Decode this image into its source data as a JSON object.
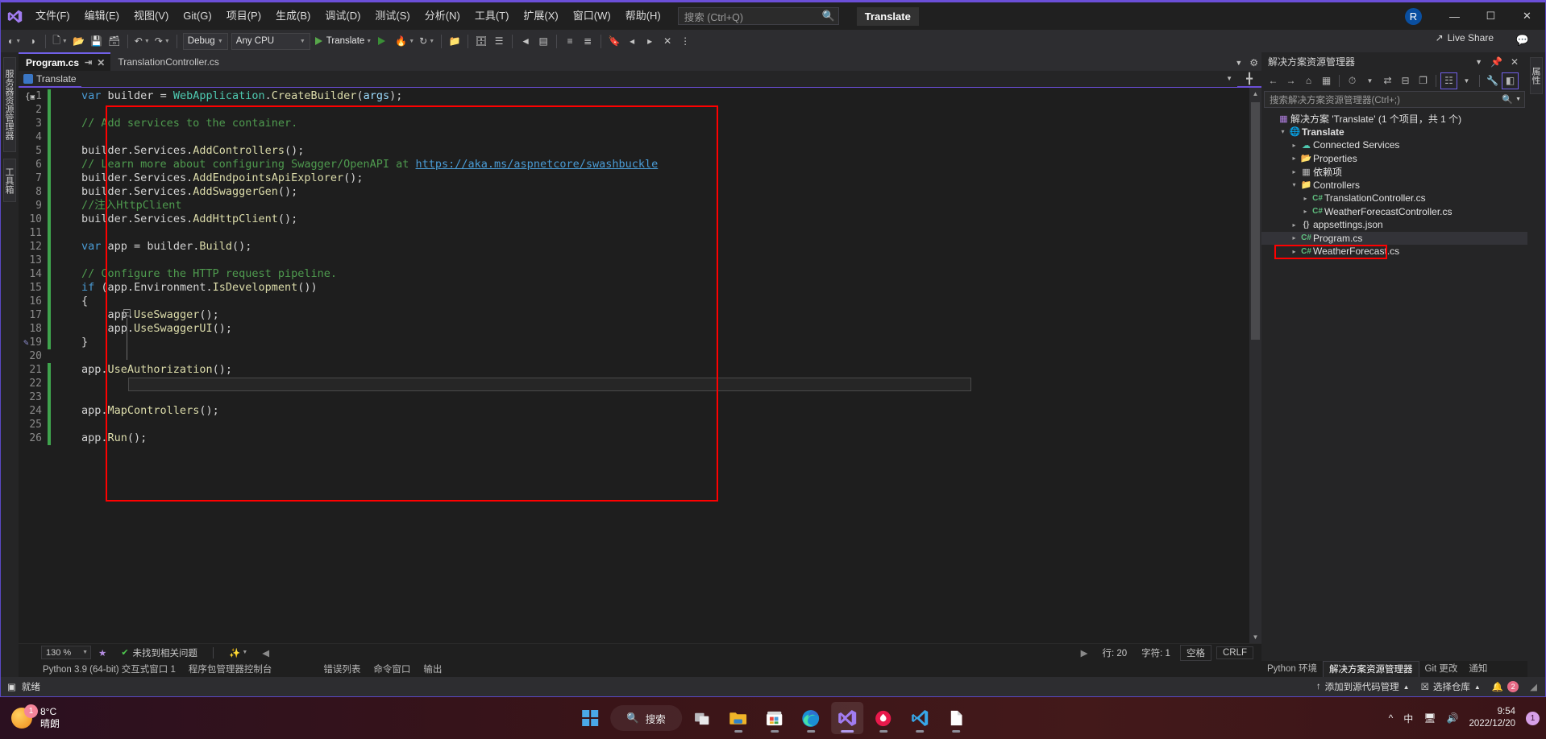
{
  "window": {
    "menu": [
      {
        "label": "文件(F)"
      },
      {
        "label": "编辑(E)"
      },
      {
        "label": "视图(V)"
      },
      {
        "label": "Git(G)"
      },
      {
        "label": "项目(P)"
      },
      {
        "label": "生成(B)"
      },
      {
        "label": "调试(D)"
      },
      {
        "label": "测试(S)"
      },
      {
        "label": "分析(N)"
      },
      {
        "label": "工具(T)"
      },
      {
        "label": "扩展(X)"
      },
      {
        "label": "窗口(W)"
      },
      {
        "label": "帮助(H)"
      }
    ],
    "search_placeholder": "搜索 (Ctrl+Q)",
    "doc_title": "Translate",
    "avatar_initial": "R",
    "minimize": "—",
    "maximize": "☐",
    "close": "✕",
    "live_share": "Live Share"
  },
  "toolbar": {
    "config": "Debug",
    "platform": "Any CPU",
    "run_label": "Translate"
  },
  "left_rail": [
    {
      "label": "服务器资源管理器"
    },
    {
      "label": "工具箱"
    }
  ],
  "far_rail": [
    {
      "label": "属性"
    }
  ],
  "editor": {
    "tabs": [
      {
        "label": "Program.cs",
        "active": true,
        "pin": "⇥",
        "close": "✕"
      },
      {
        "label": "TranslationController.cs",
        "active": false
      }
    ],
    "navbar_project": "Translate",
    "zoom": "130 %",
    "issue_status": "未找到相关问题",
    "line_label": "行: 20",
    "col_label": "字符: 1",
    "spaces_label": "空格",
    "eol_label": "CRLF",
    "code": [
      {
        "n": "1",
        "changed": true,
        "html": "<span class='kw'>var</span> <span class='id'>builder</span> = <span class='type'>WebApplication</span>.<span class='fn'>CreateBuilder</span>(<span class='var'>args</span>);"
      },
      {
        "n": "2",
        "changed": true,
        "html": ""
      },
      {
        "n": "3",
        "changed": true,
        "html": "<span class='cmt'>// Add services to the container.</span>"
      },
      {
        "n": "4",
        "changed": true,
        "html": ""
      },
      {
        "n": "5",
        "changed": true,
        "html": "<span class='id'>builder</span>.<span class='id'>Services</span>.<span class='fn'>AddControllers</span>();"
      },
      {
        "n": "6",
        "changed": true,
        "html": "<span class='cmt'>// Learn more about configuring Swagger/OpenAPI at </span><span class='link'>https://aka.ms/aspnetcore/swashbuckle</span>"
      },
      {
        "n": "7",
        "changed": true,
        "html": "<span class='id'>builder</span>.<span class='id'>Services</span>.<span class='fn'>AddEndpointsApiExplorer</span>();"
      },
      {
        "n": "8",
        "changed": true,
        "html": "<span class='id'>builder</span>.<span class='id'>Services</span>.<span class='fn'>AddSwaggerGen</span>();"
      },
      {
        "n": "9",
        "changed": true,
        "html": "<span class='cmt'>//注入HttpClient</span>"
      },
      {
        "n": "10",
        "changed": true,
        "html": "<span class='id'>builder</span>.<span class='id'>Services</span>.<span class='fn'>AddHttpClient</span>();"
      },
      {
        "n": "11",
        "changed": true,
        "html": ""
      },
      {
        "n": "12",
        "changed": true,
        "html": "<span class='kw'>var</span> <span class='id'>app</span> = <span class='id'>builder</span>.<span class='fn'>Build</span>();"
      },
      {
        "n": "13",
        "changed": true,
        "html": ""
      },
      {
        "n": "14",
        "changed": true,
        "html": "<span class='cmt'>// Configure the HTTP request pipeline.</span>"
      },
      {
        "n": "15",
        "changed": true,
        "html": "<span class='kw'>if</span> (<span class='id'>app</span>.<span class='id'>Environment</span>.<span class='fn'>IsDevelopment</span>())"
      },
      {
        "n": "16",
        "changed": true,
        "html": "{"
      },
      {
        "n": "17",
        "changed": true,
        "html": "    <span class='id'>app</span>.<span class='fn'>UseSwagger</span>();"
      },
      {
        "n": "18",
        "changed": true,
        "html": "    <span class='id'>app</span>.<span class='fn'>UseSwaggerUI</span>();"
      },
      {
        "n": "19",
        "changed": true,
        "html": "}"
      },
      {
        "n": "20",
        "changed": false,
        "html": ""
      },
      {
        "n": "21",
        "changed": true,
        "html": "<span class='id'>app</span>.<span class='fn'>UseAuthorization</span>();"
      },
      {
        "n": "22",
        "changed": true,
        "html": ""
      },
      {
        "n": "23",
        "changed": true,
        "html": ""
      },
      {
        "n": "24",
        "changed": true,
        "html": "<span class='id'>app</span>.<span class='fn'>MapControllers</span>();"
      },
      {
        "n": "25",
        "changed": true,
        "html": ""
      },
      {
        "n": "26",
        "changed": true,
        "html": "<span class='id'>app</span>.<span class='fn'>Run</span>();"
      }
    ]
  },
  "bottom_tabs": [
    {
      "label": "Python 3.9 (64-bit) 交互式窗口 1"
    },
    {
      "label": "程序包管理器控制台"
    },
    {
      "label": "错误列表"
    },
    {
      "label": "命令窗口"
    },
    {
      "label": "输出"
    }
  ],
  "solution_explorer": {
    "title": "解决方案资源管理器",
    "search_placeholder": "搜索解决方案资源管理器(Ctrl+;)",
    "tree": [
      {
        "indent": 0,
        "exp": "",
        "icon": "sln",
        "label": "解决方案 'Translate' (1 个项目，共 1 个)",
        "bold": false,
        "sel": false
      },
      {
        "indent": 1,
        "exp": "▲",
        "icon": "web",
        "label": "Translate",
        "bold": true,
        "sel": false
      },
      {
        "indent": 2,
        "exp": "▶",
        "icon": "conn",
        "label": "Connected Services",
        "bold": false,
        "sel": false
      },
      {
        "indent": 2,
        "exp": "▶",
        "icon": "prop",
        "label": "Properties",
        "bold": false,
        "sel": false
      },
      {
        "indent": 2,
        "exp": "▶",
        "icon": "dep",
        "label": "依赖项",
        "bold": false,
        "sel": false
      },
      {
        "indent": 2,
        "exp": "▲",
        "icon": "fold",
        "label": "Controllers",
        "bold": false,
        "sel": false
      },
      {
        "indent": 3,
        "exp": "▶",
        "icon": "cs",
        "label": "TranslationController.cs",
        "bold": false,
        "sel": false
      },
      {
        "indent": 3,
        "exp": "▶",
        "icon": "cs",
        "label": "WeatherForecastController.cs",
        "bold": false,
        "sel": false
      },
      {
        "indent": 2,
        "exp": "▶",
        "icon": "json",
        "label": "appsettings.json",
        "bold": false,
        "sel": false
      },
      {
        "indent": 2,
        "exp": "▶",
        "icon": "cs",
        "label": "Program.cs",
        "bold": false,
        "sel": true
      },
      {
        "indent": 2,
        "exp": "▶",
        "icon": "cs",
        "label": "WeatherForecast.cs",
        "bold": false,
        "sel": false
      }
    ],
    "tabs": [
      {
        "label": "Python 环境",
        "active": false
      },
      {
        "label": "解决方案资源管理器",
        "active": true
      },
      {
        "label": "Git 更改",
        "active": false
      },
      {
        "label": "通知",
        "active": false
      }
    ]
  },
  "status_bar": {
    "ready": "就绪",
    "add_to_source": "添加到源代码管理",
    "select_repo": "选择仓库",
    "notification_count": "2"
  },
  "taskbar": {
    "weather_temp": "8°C",
    "weather_desc": "晴朗",
    "weather_badge": "1",
    "search_label": "搜索",
    "ime": "中",
    "time": "9:54",
    "date": "2022/12/20",
    "tray_badge": "1",
    "icons": [
      {
        "name": "start-icon"
      },
      {
        "name": "search-pill"
      },
      {
        "name": "task-view-icon"
      },
      {
        "name": "file-explorer-icon"
      },
      {
        "name": "microsoft-store-icon"
      },
      {
        "name": "edge-icon"
      },
      {
        "name": "visual-studio-icon"
      },
      {
        "name": "hbuilder-icon"
      },
      {
        "name": "vscode-icon"
      },
      {
        "name": "notepad-icon"
      }
    ]
  },
  "colors": {
    "accent": "#6b4fd8",
    "annotation": "#ff0000",
    "changed_line": "#3fa34d"
  }
}
